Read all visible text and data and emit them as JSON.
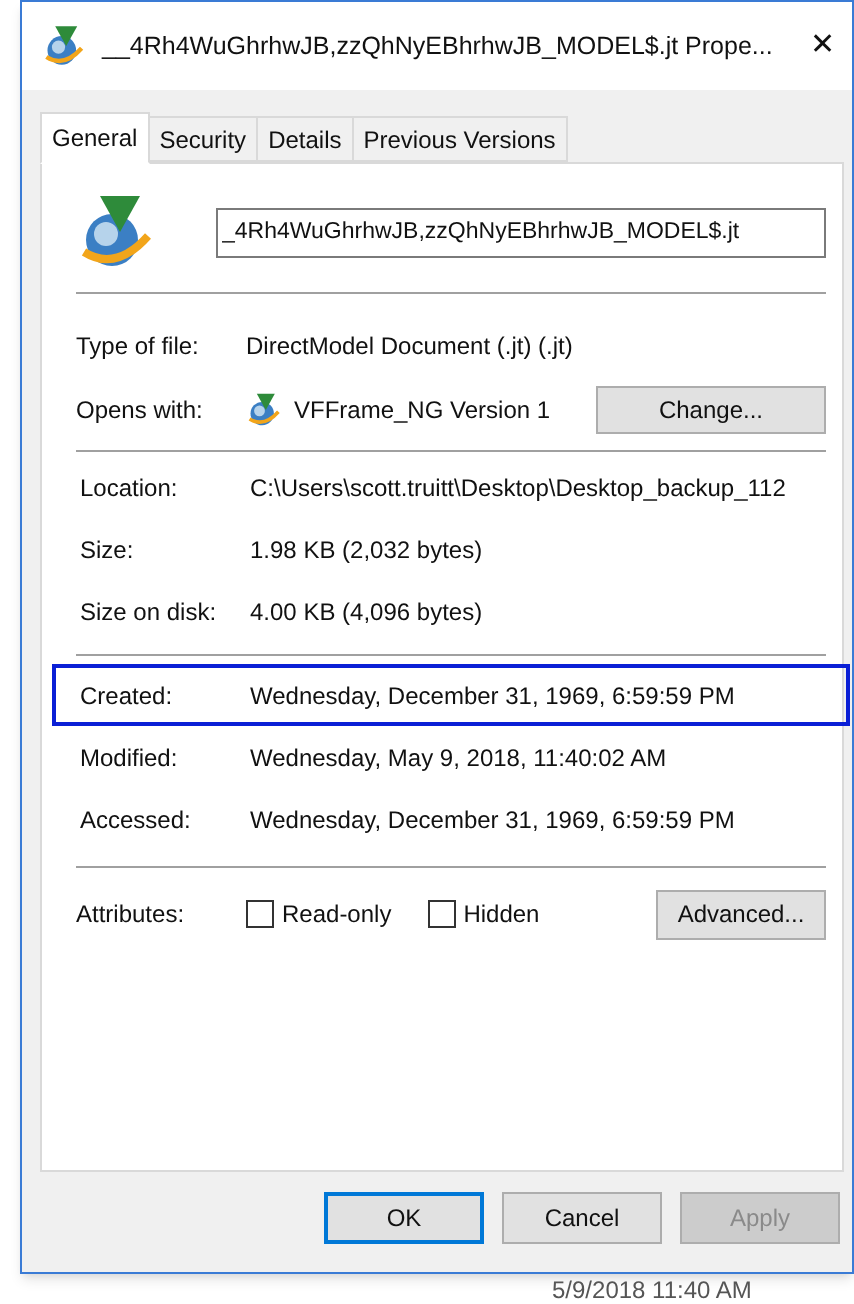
{
  "window": {
    "title": "__4Rh4WuGhrhwJB,zzQhNyEBhrhwJB_MODEL$.jt Prope...",
    "close": "✕"
  },
  "tabs": [
    {
      "label": "General",
      "selected": true
    },
    {
      "label": "Security",
      "selected": false
    },
    {
      "label": "Details",
      "selected": false
    },
    {
      "label": "Previous Versions",
      "selected": false
    }
  ],
  "file_name": {
    "value": "_4Rh4WuGhrhwJB,zzQhNyEBhrhwJB_MODEL$.jt"
  },
  "type_section": [
    {
      "label": "Type of file:",
      "value": "DirectModel Document (.jt) (.jt)"
    },
    {
      "label": "Opens with:",
      "value": "VFFrame_NG Version 1",
      "button": "Change..."
    }
  ],
  "location_section": [
    {
      "label": "Location:",
      "value": "C:\\Users\\scott.truitt\\Desktop\\Desktop_backup_112"
    },
    {
      "label": "Size:",
      "value": "1.98 KB (2,032 bytes)"
    },
    {
      "label": "Size on disk:",
      "value": "4.00 KB (4,096 bytes)"
    }
  ],
  "date_section": [
    {
      "label": "Created:",
      "value": "Wednesday, December 31, 1969, 6:59:59 PM",
      "highlighted": true
    },
    {
      "label": "Modified:",
      "value": "Wednesday, May 9, 2018, 11:40:02 AM",
      "highlighted": false
    },
    {
      "label": "Accessed:",
      "value": "Wednesday, December 31, 1969, 6:59:59 PM",
      "highlighted": false
    }
  ],
  "attributes": {
    "label": "Attributes:",
    "checkboxes": [
      {
        "label": "Read-only",
        "checked": false
      },
      {
        "label": "Hidden",
        "checked": false
      }
    ],
    "button": "Advanced..."
  },
  "buttons": [
    {
      "label": "OK",
      "kind": "default",
      "disabled": false
    },
    {
      "label": "Cancel",
      "kind": "normal",
      "disabled": false
    },
    {
      "label": "Apply",
      "kind": "normal",
      "disabled": true
    }
  ],
  "background_row": {
    "date": "5/9/2018 11:40 AM"
  }
}
